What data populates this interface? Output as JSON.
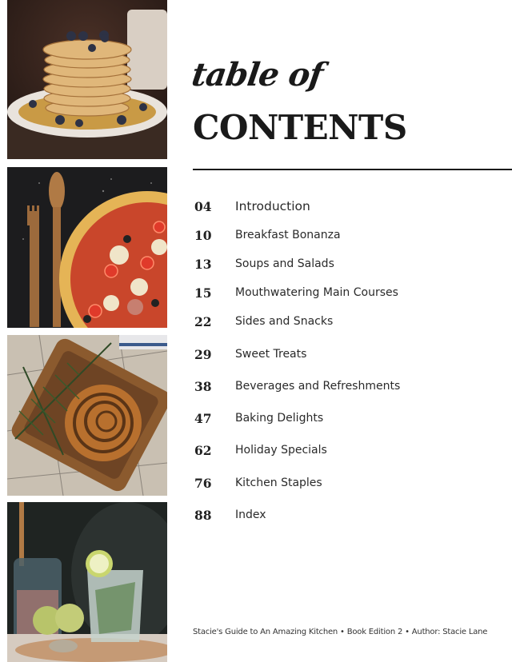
{
  "header": {
    "script_title": "table of",
    "main_title": "CONTENTS"
  },
  "toc": {
    "entries": [
      {
        "page": "04",
        "title": "Introduction"
      },
      {
        "page": "10",
        "title": "Breakfast Bonanza"
      },
      {
        "page": "13",
        "title": "Soups and Salads"
      },
      {
        "page": "15",
        "title": "Mouthwatering Main Courses"
      },
      {
        "page": "22",
        "title": "Sides and Snacks"
      },
      {
        "page": "29",
        "title": "Sweet Treats"
      },
      {
        "page": "38",
        "title": "Beverages and Refreshments"
      },
      {
        "page": "47",
        "title": "Baking Delights"
      },
      {
        "page": "62",
        "title": "Holiday Specials"
      },
      {
        "page": "76",
        "title": "Kitchen Staples"
      },
      {
        "page": "88",
        "title": "Index"
      }
    ]
  },
  "photos": [
    {
      "subject": "pancake-stack-with-blueberries"
    },
    {
      "subject": "pizza-with-wooden-utensils"
    },
    {
      "subject": "cinnamon-swirl-pastry-on-wooden-tray"
    },
    {
      "subject": "mojito-drink-with-limes"
    }
  ],
  "footer": {
    "text": "Stacie's Guide to An Amazing Kitchen • Book Edition 2 • Author: Stacie Lane"
  }
}
